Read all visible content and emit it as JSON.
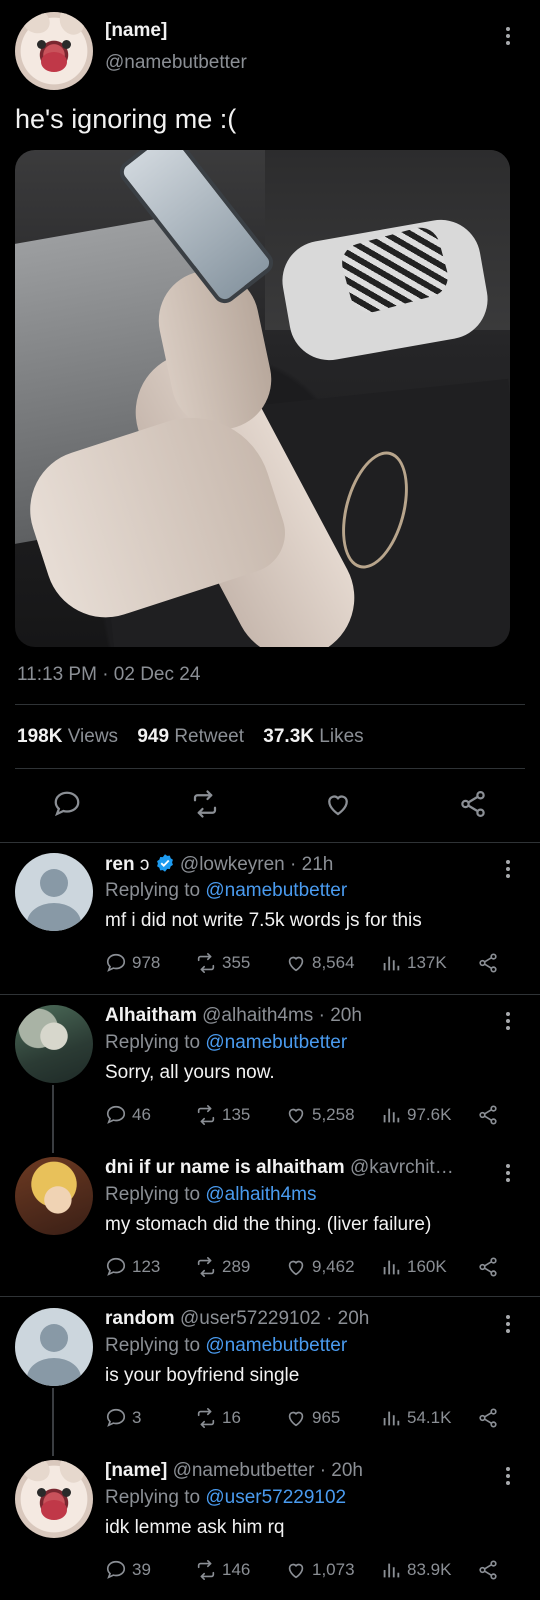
{
  "main": {
    "name": "[name]",
    "handle": "@namebutbetter",
    "text": "he's ignoring me :(",
    "timestamp": "11:13 PM · 02 Dec 24",
    "stats": {
      "views_count": "198K",
      "views_label": "Views",
      "retweets_count": "949",
      "retweets_label": "Retweet",
      "likes_count": "37.3K",
      "likes_label": "Likes"
    }
  },
  "replies": [
    {
      "name": "ren",
      "name_emoji": "ↄ",
      "verified": true,
      "handle": "@lowkeyren",
      "time": "· 21h",
      "replying_prefix": "Replying to",
      "replying_to": "@namebutbetter",
      "text": "mf i did not write 7.5k words js for this",
      "replies": "978",
      "retweets": "355",
      "likes": "8,564",
      "views": "137K"
    },
    {
      "name": "Alhaitham",
      "handle": "@alhaith4ms",
      "time": "· 20h",
      "replying_prefix": "Replying to",
      "replying_to": "@namebutbetter",
      "text": "Sorry, all yours now.",
      "replies": "46",
      "retweets": "135",
      "likes": "5,258",
      "views": "97.6K"
    },
    {
      "name": "dni if ur name is alhaitham",
      "handle": "@kavrchit…",
      "time": "",
      "replying_prefix": "Replying to",
      "replying_to": "@alhaith4ms",
      "text": "my stomach did the thing. (liver failure)",
      "replies": "123",
      "retweets": "289",
      "likes": "9,462",
      "views": "160K"
    },
    {
      "name": "random",
      "handle": "@user57229102",
      "time": "· 20h",
      "replying_prefix": "Replying to",
      "replying_to": "@namebutbetter",
      "text": "is your boyfriend single",
      "replies": "3",
      "retweets": "16",
      "likes": "965",
      "views": "54.1K"
    },
    {
      "name": "[name]",
      "handle": "@namebutbetter",
      "time": "· 20h",
      "replying_prefix": "Replying to",
      "replying_to": "@user57229102",
      "text": "idk lemme ask him rq",
      "replies": "39",
      "retweets": "146",
      "likes": "1,073",
      "views": "83.9K"
    }
  ],
  "colors": {
    "background": "#000000",
    "text": "#e7e9ea",
    "muted": "#8b8f95",
    "link": "#4a9bef",
    "verified": "#1d9bf0"
  },
  "icons": [
    "reply-icon",
    "retweet-icon",
    "like-icon",
    "share-icon",
    "views-icon",
    "verified-icon",
    "more-icon"
  ]
}
